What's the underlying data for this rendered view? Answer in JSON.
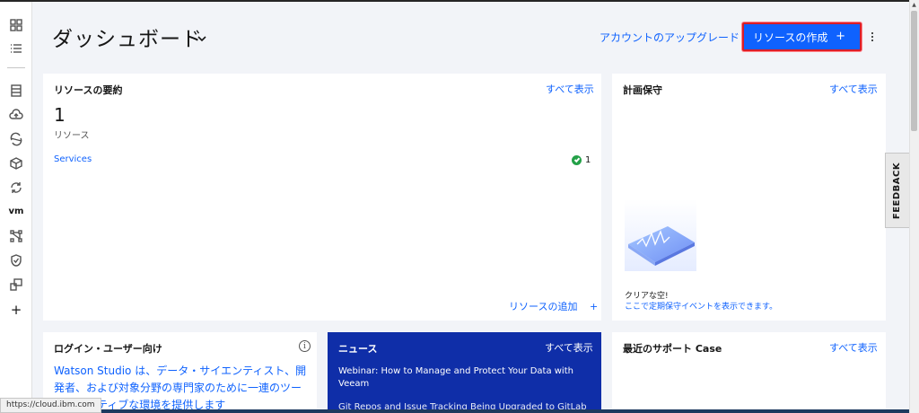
{
  "header": {
    "title": "ダッシュボード",
    "upgrade_link": "アカウントのアップグレード",
    "create_button": "リソースの作成",
    "create_plus": "+"
  },
  "sidebar": {
    "items": [
      {
        "icon": "dashboard-grid-icon"
      },
      {
        "icon": "list-icon"
      },
      {
        "icon": "documents-icon"
      },
      {
        "icon": "cloud-upload-icon"
      },
      {
        "icon": "openshift-icon"
      },
      {
        "icon": "cube-icon"
      },
      {
        "icon": "refresh-cycle-icon"
      },
      {
        "icon": "vm-icon",
        "label": "vm"
      },
      {
        "icon": "network-nodes-icon"
      },
      {
        "icon": "shield-check-icon"
      },
      {
        "icon": "devices-icon"
      },
      {
        "icon": "plus-icon",
        "label": "+"
      }
    ]
  },
  "resource_summary": {
    "title": "リソースの要約",
    "view_all": "すべて表示",
    "count": "1",
    "count_label": "リソース",
    "services_label": "Services",
    "services_count": "1",
    "add_resource": "リソースの追加",
    "add_plus": "+"
  },
  "planned_maintenance": {
    "title": "計画保守",
    "view_all": "すべて表示",
    "empty_title": "クリアな空!",
    "empty_link": "ここで定期保守イベントを表示できます。"
  },
  "login_card": {
    "title": "ログイン・ユーザー向け",
    "info": "i",
    "body": "Watson Studio は、データ・サイエンティスト、開発者、および対象分野の専門家のために一連のツーラボレーティブな環境を提供します"
  },
  "news": {
    "title": "ニュース",
    "view_all": "すべて表示",
    "item1": "Webinar: How to Manage and Protect Your Data with Veeam",
    "item2": "Git Repos and Issue Tracking Being Upgraded to GitLab"
  },
  "support_cases": {
    "title": "最近のサポート Case",
    "view_all": "すべて表示"
  },
  "feedback_tab": "FEEDBACK",
  "status_url": "https://cloud.ibm.com",
  "colors": {
    "primary": "#0f62fe",
    "highlight_border": "#da1e28",
    "news_bg": "#0f2ea8",
    "success": "#24a148"
  }
}
